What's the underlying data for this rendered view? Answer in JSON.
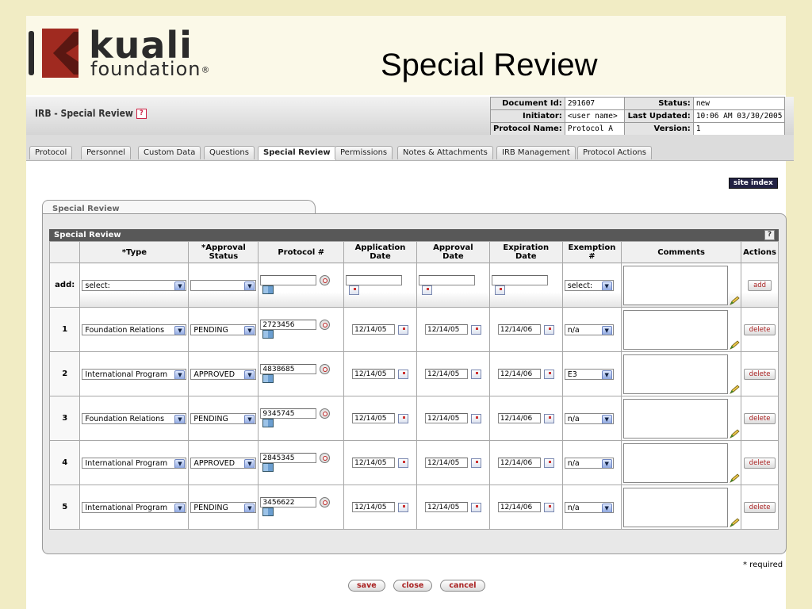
{
  "slide": {
    "logo_text_top": "kuali",
    "logo_text_bottom": "foundation",
    "logo_reg": "®",
    "title": "Special Review"
  },
  "document": {
    "title": "IRB - Special Review",
    "info": {
      "doc_id_label": "Document Id:",
      "doc_id": "291607",
      "status_label": "Status:",
      "status": "new",
      "initiator_label": "Initiator:",
      "initiator": "<user name>",
      "last_updated_label": "Last Updated:",
      "last_updated": "10:06 AM 03/30/2005",
      "protocol_name_label": "Protocol Name:",
      "protocol_name": "Protocol A",
      "version_label": "Version:",
      "version": "1"
    }
  },
  "tabs": [
    "Protocol",
    "Personnel",
    "Custom Data",
    "Questions",
    "Special Review",
    "Permissions",
    "Notes & Attachments",
    "IRB Management",
    "Protocol Actions"
  ],
  "site_index": "site index",
  "panel": {
    "tab_label": "Special Review",
    "section_title": "Special Review",
    "help": "?"
  },
  "columns": {
    "type": "*Type",
    "approval_status_1": "*Approval",
    "approval_status_2": "Status",
    "protocol": "Protocol #",
    "application_1": "Application",
    "application_2": "Date",
    "approval_1": "Approval",
    "approval_2": "Date",
    "expiration_1": "Expiration",
    "expiration_2": "Date",
    "exemption_1": "Exemption",
    "exemption_2": "#",
    "comments": "Comments",
    "actions": "Actions"
  },
  "add_row": {
    "label": "add:",
    "type": "select:",
    "approval_status": "",
    "protocol": "",
    "application_date": "",
    "approval_date": "",
    "expiration_date": "",
    "exemption": "select:",
    "button": "add"
  },
  "rows": [
    {
      "num": "1",
      "type": "Foundation Relations",
      "status": "PENDING",
      "protocol": "2723456",
      "application": "12/14/05",
      "approval": "12/14/05",
      "expiration": "12/14/06",
      "exemption": "n/a",
      "action": "delete"
    },
    {
      "num": "2",
      "type": "International Program",
      "status": "APPROVED",
      "protocol": "4838685",
      "application": "12/14/05",
      "approval": "12/14/05",
      "expiration": "12/14/06",
      "exemption": "E3",
      "action": "delete"
    },
    {
      "num": "3",
      "type": "Foundation Relations",
      "status": "PENDING",
      "protocol": "9345745",
      "application": "12/14/05",
      "approval": "12/14/05",
      "expiration": "12/14/06",
      "exemption": "n/a",
      "action": "delete"
    },
    {
      "num": "4",
      "type": "International Program",
      "status": "APPROVED",
      "protocol": "2845345",
      "application": "12/14/05",
      "approval": "12/14/05",
      "expiration": "12/14/06",
      "exemption": "n/a",
      "action": "delete"
    },
    {
      "num": "5",
      "type": "International Program",
      "status": "PENDING",
      "protocol": "3456622",
      "application": "12/14/05",
      "approval": "12/14/05",
      "expiration": "12/14/06",
      "exemption": "n/a",
      "action": "delete"
    }
  ],
  "required_note": "* required",
  "buttons": {
    "save": "save",
    "close": "close",
    "cancel": "cancel"
  },
  "icons": {
    "dropdown": "chevron-down-icon",
    "lookup": "magnifier-icon",
    "direct_inquiry": "book-icon",
    "calendar": "calendar-icon",
    "comment_edit": "pencil-icon",
    "help": "help-icon"
  },
  "colors": {
    "slide_bg": "#f1ecc4",
    "logo_red": "#a02a20",
    "section_bar": "#585858",
    "button_text": "#aa2222"
  }
}
